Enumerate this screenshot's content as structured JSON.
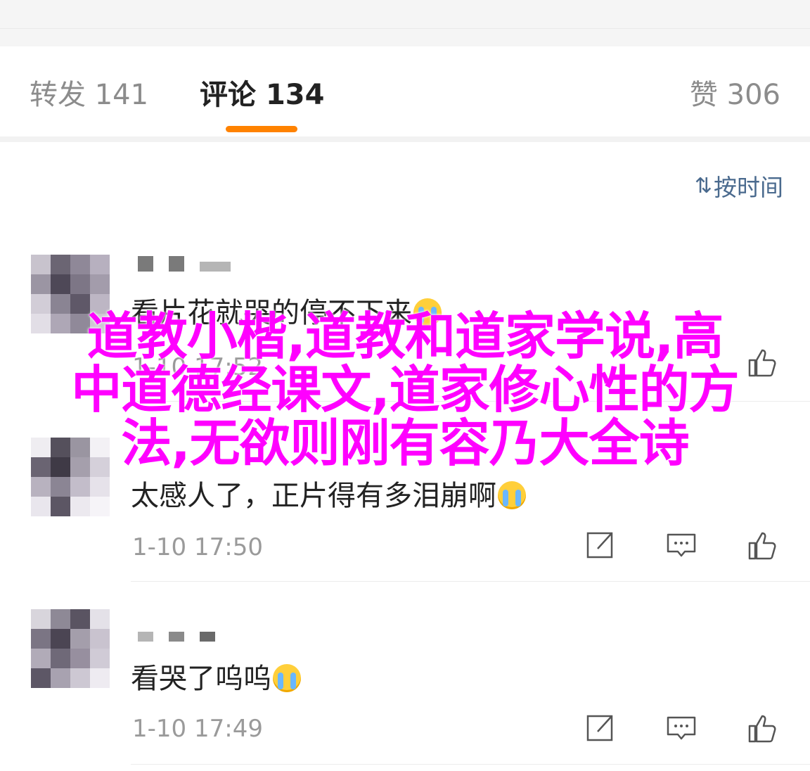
{
  "tabs": {
    "forward": {
      "label": "转发",
      "count": "141"
    },
    "comments": {
      "label": "评论",
      "count": "134"
    },
    "likes": {
      "label": "赞",
      "count": "306"
    }
  },
  "sort": {
    "label": "按时间",
    "icon": "sort-icon"
  },
  "comments": [
    {
      "text": "看片花就哭的停不下来",
      "time": "1-10 17:52"
    },
    {
      "text": "太感人了，正片得有多泪崩啊",
      "time": "1-10 17:50"
    },
    {
      "text": "看哭了呜呜",
      "time": "1-10 17:49"
    }
  ],
  "overlay": {
    "line1": "道教小楷,道教和道家学说,高",
    "line2": "中道德经课文,道家修心性的方",
    "line3": "法,无欲则刚有容乃大全诗"
  },
  "colors": {
    "accent": "#ff8200",
    "overlay": "#ff00ff",
    "sort": "#4a6a8e"
  }
}
